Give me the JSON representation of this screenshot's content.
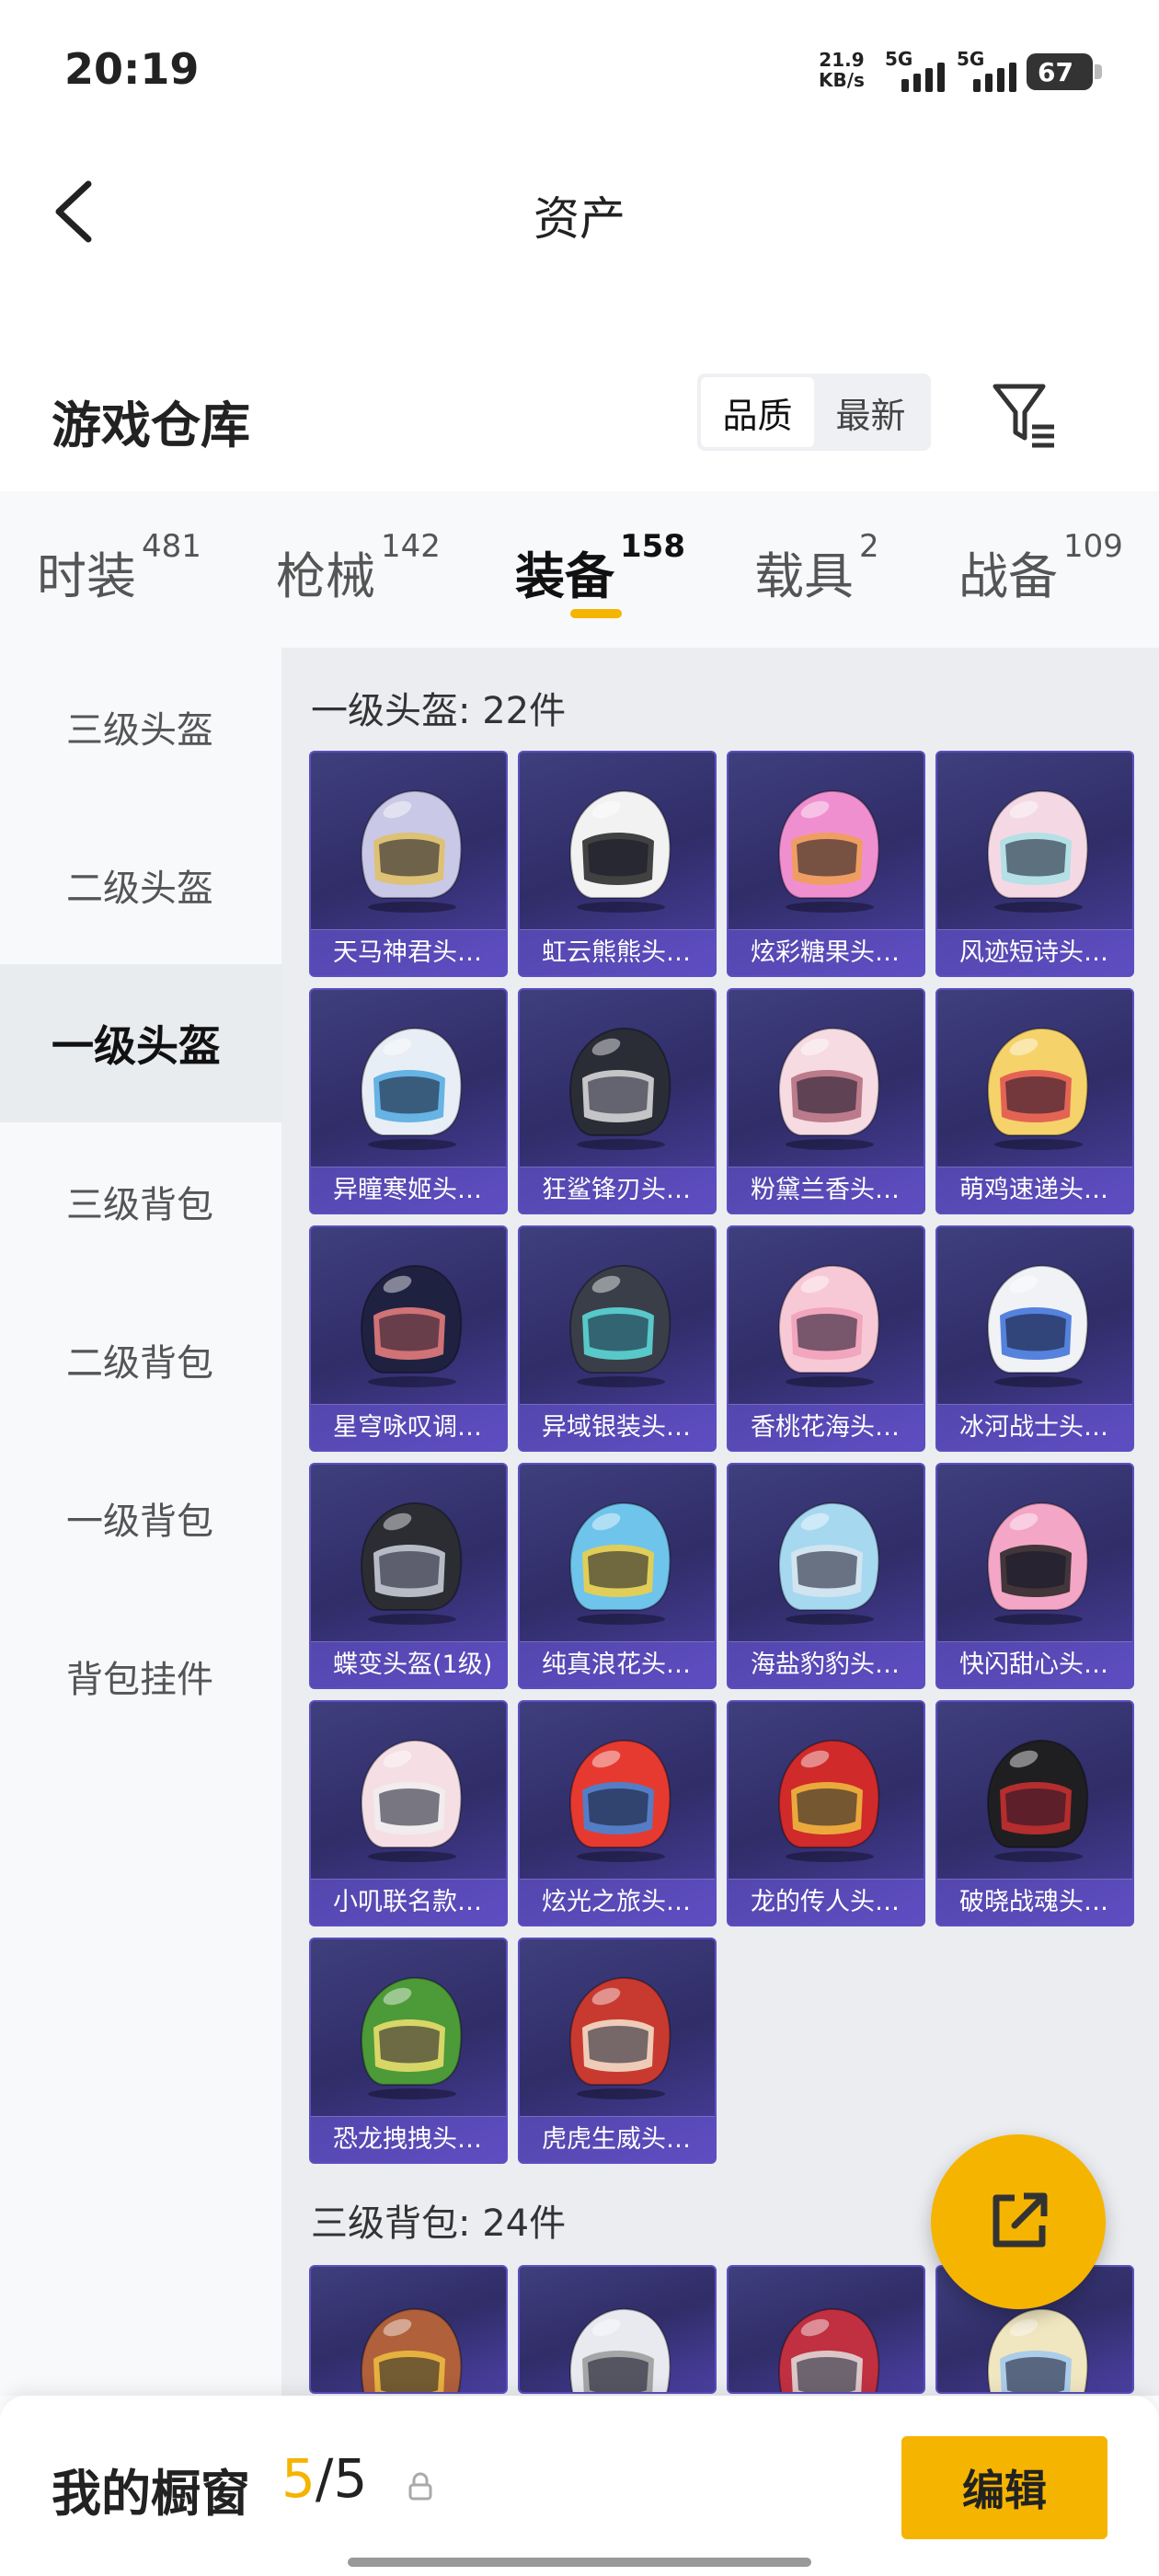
{
  "status_bar": {
    "time": "20:19",
    "net_speed": "21.9",
    "net_unit": "KB/s",
    "sig1_label": "5G",
    "sig2_label": "5G",
    "battery": "67"
  },
  "header": {
    "title": "资产"
  },
  "section": {
    "title": "游戏仓库",
    "sort_options": [
      "品质",
      "最新"
    ],
    "sort_selected": "品质"
  },
  "tabs": [
    {
      "label": "时装",
      "count": "481"
    },
    {
      "label": "枪械",
      "count": "142"
    },
    {
      "label": "装备",
      "count": "158"
    },
    {
      "label": "载具",
      "count": "2"
    },
    {
      "label": "战备",
      "count": "109"
    }
  ],
  "active_tab": "装备",
  "sidebar": [
    "三级头盔",
    "二级头盔",
    "一级头盔",
    "三级背包",
    "二级背包",
    "一级背包",
    "背包挂件"
  ],
  "sidebar_active": "一级头盔",
  "groups": [
    {
      "heading": "一级头盔: 22件",
      "items": [
        {
          "name": "天马神君头…",
          "color": "#c9c8e6",
          "accent": "#e0c060"
        },
        {
          "name": "虹云熊熊头…",
          "color": "#f2f2f2",
          "accent": "#222222"
        },
        {
          "name": "炫彩糖果头…",
          "color": "#f08fd0",
          "accent": "#f0a050"
        },
        {
          "name": "风迹短诗头…",
          "color": "#f4d9e4",
          "accent": "#a8e0e6"
        },
        {
          "name": "异瞳寒姬头…",
          "color": "#e8eef5",
          "accent": "#4fa8e0"
        },
        {
          "name": "狂鲨锋刃头…",
          "color": "#2a2d36",
          "accent": "#e0e0e0"
        },
        {
          "name": "粉黛兰香头…",
          "color": "#f6dbe2",
          "accent": "#b06a7a"
        },
        {
          "name": "萌鸡速递头…",
          "color": "#f5d36a",
          "accent": "#e05050"
        },
        {
          "name": "星穹咏叹调…",
          "color": "#1e2240",
          "accent": "#f08080"
        },
        {
          "name": "异域银装头…",
          "color": "#3a3e48",
          "accent": "#5ee0e0"
        },
        {
          "name": "香桃花海头…",
          "color": "#f7c9d6",
          "accent": "#f0a0b8"
        },
        {
          "name": "冰河战士头…",
          "color": "#f0f2f6",
          "accent": "#3a6ed8"
        },
        {
          "name": "蝶变头盔(1级)",
          "color": "#2b2d33",
          "accent": "#cfd5e0"
        },
        {
          "name": "纯真浪花头…",
          "color": "#6fc4ec",
          "accent": "#f5d040"
        },
        {
          "name": "海盐豹豹头…",
          "color": "#a6d8f0",
          "accent": "#d8e6ee"
        },
        {
          "name": "快闪甜心头…",
          "color": "#f3a6c6",
          "accent": "#222222"
        },
        {
          "name": "小叽联名款…",
          "color": "#f5dfe4",
          "accent": "#f0f0f0"
        },
        {
          "name": "炫光之旅头…",
          "color": "#e63a30",
          "accent": "#3a8ae0"
        },
        {
          "name": "龙的传人头…",
          "color": "#d02a2a",
          "accent": "#f0c040"
        },
        {
          "name": "破晓战魂头…",
          "color": "#1f1f22",
          "accent": "#d03030"
        },
        {
          "name": "恐龙拽拽头…",
          "color": "#4c9a38",
          "accent": "#f0e070"
        },
        {
          "name": "虎虎生威头…",
          "color": "#c83a30",
          "accent": "#f5e6d0"
        }
      ]
    },
    {
      "heading": "三级背包: 24件",
      "items": [
        {
          "name": "",
          "color": "#b0603a",
          "accent": "#f0c040"
        },
        {
          "name": "",
          "color": "#e8eaf0",
          "accent": "#999999"
        },
        {
          "name": "",
          "color": "#c03040",
          "accent": "#e0e0e0"
        },
        {
          "name": "",
          "color": "#f0e6c0",
          "accent": "#a0c8f0"
        }
      ]
    }
  ],
  "showcase": {
    "label": "我的橱窗",
    "used": "5",
    "separator": "/",
    "total": "5",
    "edit_label": "编辑"
  },
  "colors": {
    "accent": "#f5b400",
    "card_bg": "#302d68"
  }
}
